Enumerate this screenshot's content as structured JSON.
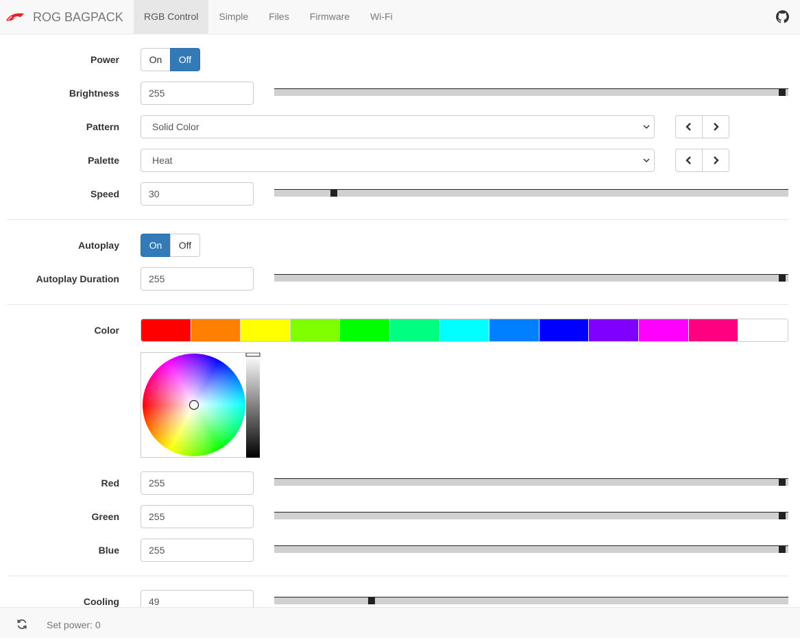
{
  "app": {
    "brand": "ROG BAGPACK",
    "logo_icon": "rog-eye-icon"
  },
  "nav": {
    "tabs": [
      {
        "label": "RGB Control",
        "active": true
      },
      {
        "label": "Simple",
        "active": false
      },
      {
        "label": "Files",
        "active": false
      },
      {
        "label": "Firmware",
        "active": false
      },
      {
        "label": "Wi-Fi",
        "active": false
      }
    ],
    "github_icon": "github-icon"
  },
  "controls": {
    "power": {
      "label": "Power",
      "on": "On",
      "off": "Off",
      "selected": "Off"
    },
    "brightness": {
      "label": "Brightness",
      "value": "255",
      "max": 255
    },
    "pattern": {
      "label": "Pattern",
      "value": "Solid Color"
    },
    "palette": {
      "label": "Palette",
      "value": "Heat"
    },
    "speed": {
      "label": "Speed",
      "value": "30",
      "max": 255
    },
    "autoplay": {
      "label": "Autoplay",
      "on": "On",
      "off": "Off",
      "selected": "On"
    },
    "autoplay_duration": {
      "label": "Autoplay Duration",
      "value": "255",
      "max": 255
    },
    "color": {
      "label": "Color",
      "swatches": [
        "#ff0000",
        "#ff8000",
        "#ffff00",
        "#80ff00",
        "#00ff00",
        "#00ff80",
        "#00ffff",
        "#0080ff",
        "#0000ff",
        "#8000ff",
        "#ff00ff",
        "#ff0080",
        "#ffffff"
      ]
    },
    "red": {
      "label": "Red",
      "value": "255",
      "max": 255
    },
    "green": {
      "label": "Green",
      "value": "255",
      "max": 255
    },
    "blue": {
      "label": "Blue",
      "value": "255",
      "max": 255
    },
    "cooling": {
      "label": "Cooling",
      "value": "49",
      "max": 255
    }
  },
  "footer": {
    "status": "Set power: 0",
    "refresh_icon": "refresh-icon"
  },
  "colors": {
    "primary": "#337ab7",
    "navbar_bg": "#f8f8f8",
    "accent_red": "#e8202a"
  }
}
